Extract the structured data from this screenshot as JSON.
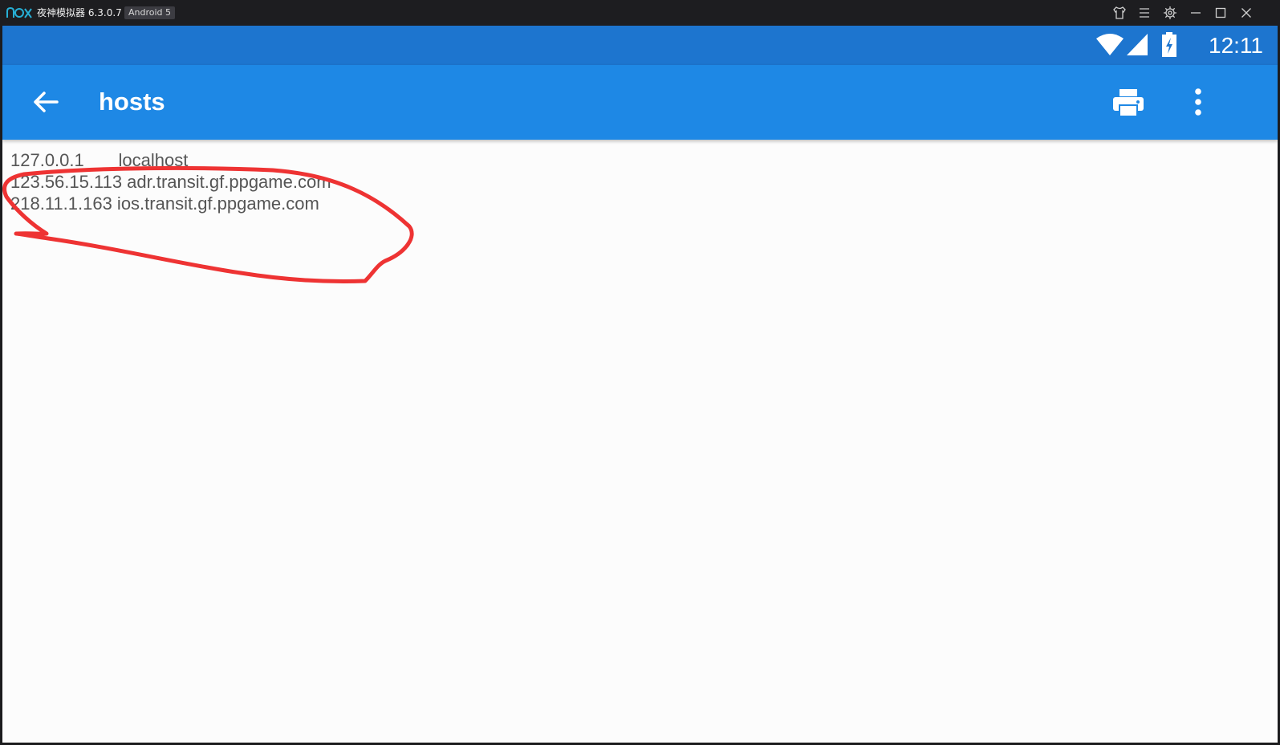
{
  "window": {
    "app_name": "夜神模拟器 6.3.0.7",
    "android_badge": "Android 5"
  },
  "statusbar": {
    "time": "12:11"
  },
  "appbar": {
    "title": "hosts"
  },
  "hosts": {
    "lines": [
      "127.0.0.1       localhost",
      "123.56.15.113 adr.transit.gf.ppgame.com",
      "218.11.1.163 ios.transit.gf.ppgame.com"
    ]
  },
  "colors": {
    "statusbar_bg": "#1d75cf",
    "appbar_bg": "#1e88e5",
    "annotation_stroke": "#ee3333"
  }
}
